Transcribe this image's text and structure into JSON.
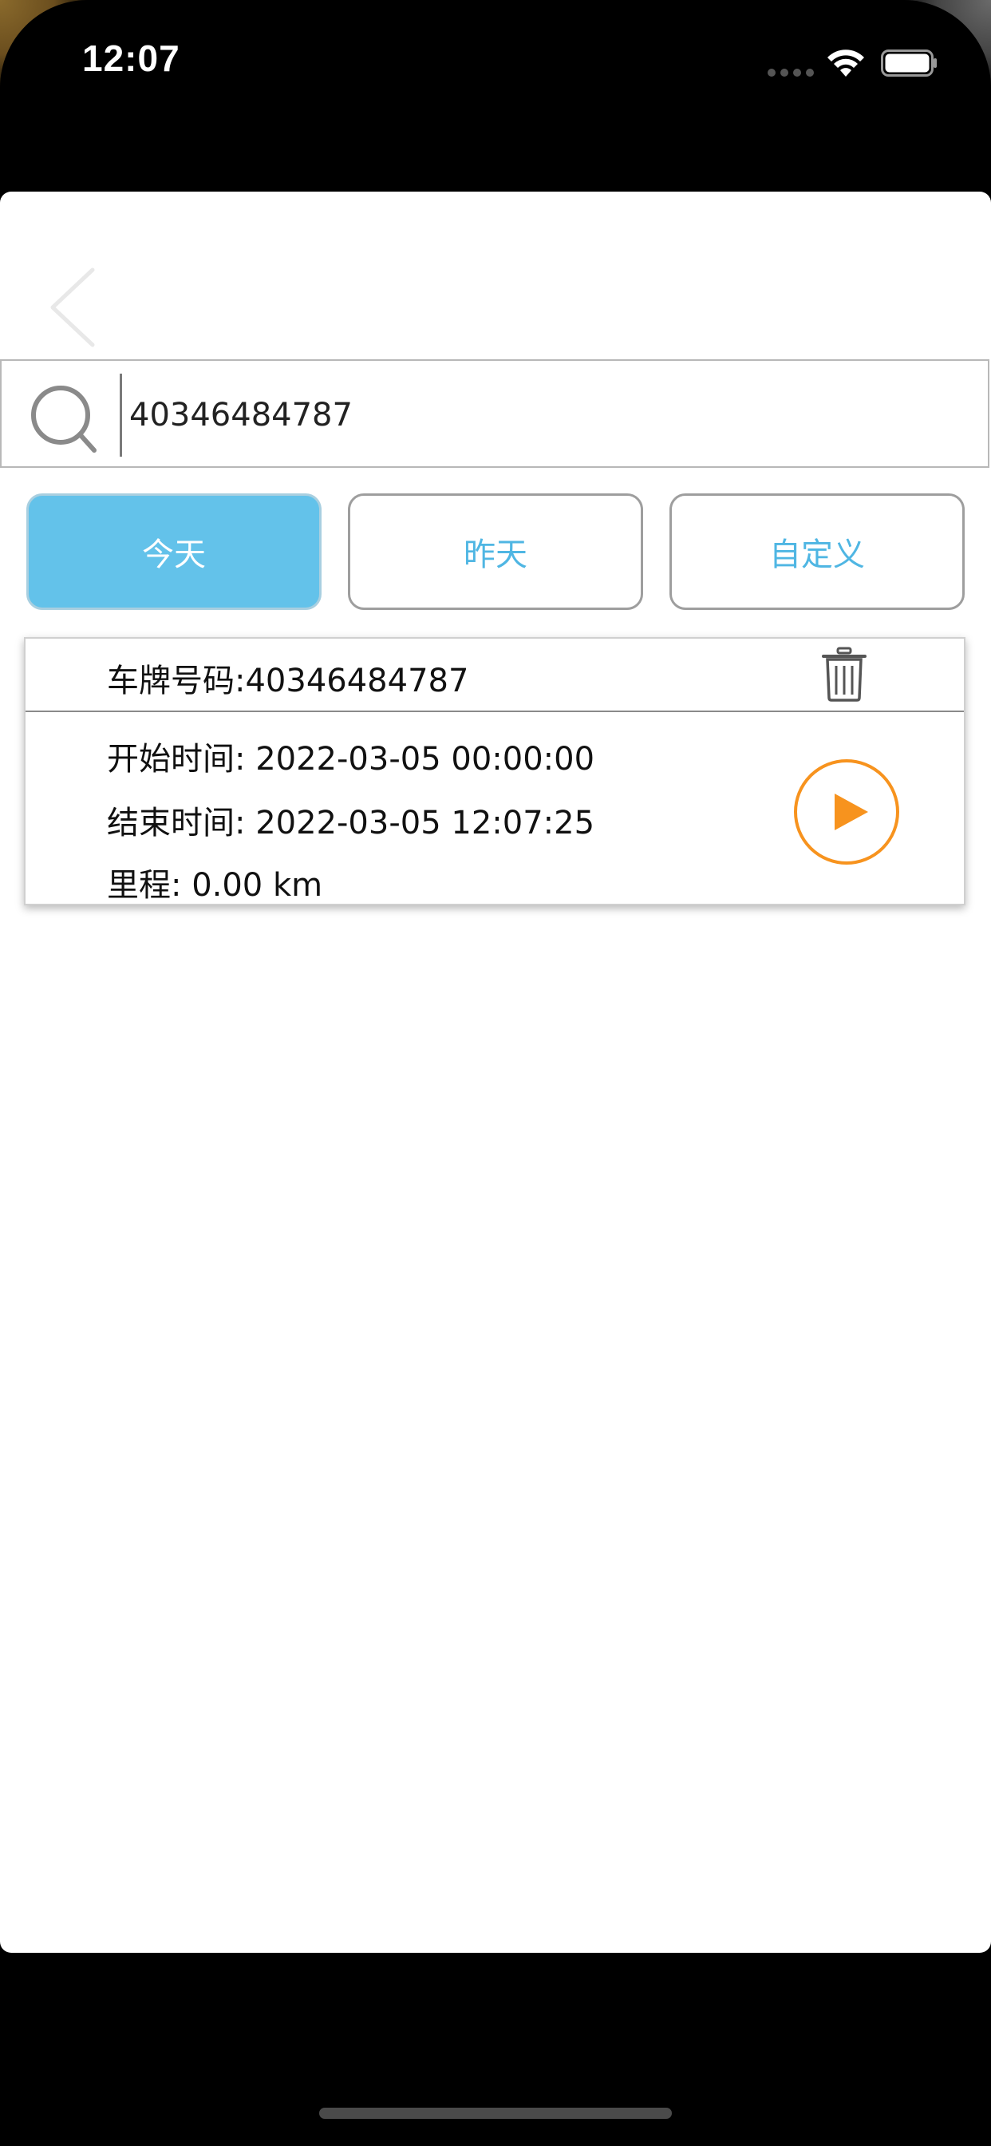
{
  "status_bar": {
    "time": "12:07"
  },
  "search": {
    "value": "40346484787"
  },
  "date_filters": [
    {
      "label": "今天",
      "active": true
    },
    {
      "label": "昨天",
      "active": false
    },
    {
      "label": "自定义",
      "active": false
    }
  ],
  "record": {
    "plate_label": "车牌号码:40346484787",
    "start_time": "开始时间: 2022-03-05 00:00:00",
    "end_time": "结束时间: 2022-03-05 12:07:25",
    "mileage": "里程: 0.00 km"
  },
  "colors": {
    "accent_blue": "#63c2ea",
    "text_blue": "#4fb6e3",
    "play_orange": "#f7931e"
  }
}
